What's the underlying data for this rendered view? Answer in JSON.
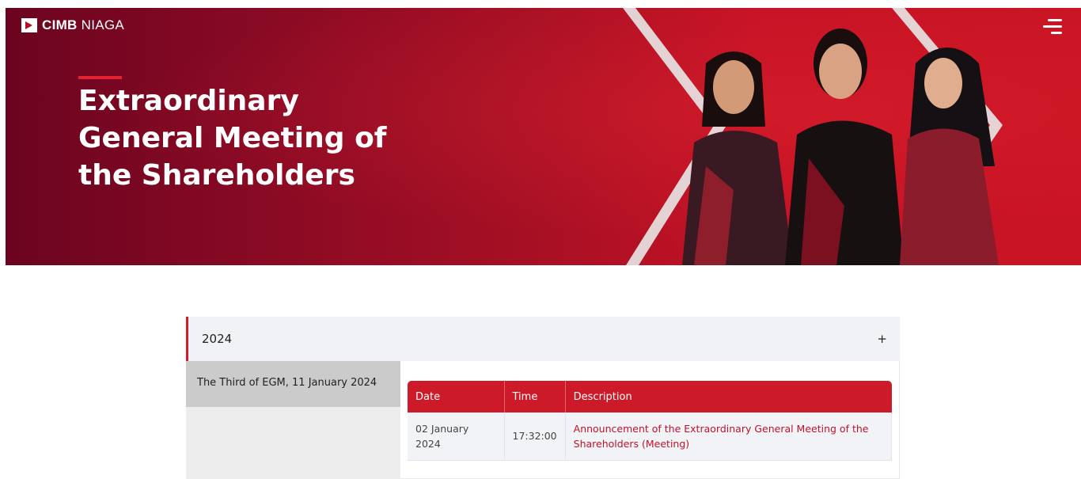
{
  "brand": {
    "name_bold": "CIMB",
    "name_regular": "NIAGA"
  },
  "header": {
    "menu_icon": "hamburger-menu-icon"
  },
  "hero": {
    "title": "Extraordinary General Meeting of the Shareholders"
  },
  "colors": {
    "brand_red": "#cc1a28",
    "hero_dark": "#6b0420",
    "link_red": "#c0122a"
  },
  "accordion": {
    "year": "2024",
    "toggle": "+",
    "tabs": [
      {
        "label": "The Third of EGM, 11 January 2024"
      }
    ],
    "table": {
      "headers": [
        "Date",
        "Time",
        "Description"
      ],
      "rows": [
        {
          "date": "02 January 2024",
          "time": "17:32:00",
          "description": "Announcement of the Extraordinary General Meeting of the Shareholders (Meeting)"
        }
      ]
    }
  }
}
